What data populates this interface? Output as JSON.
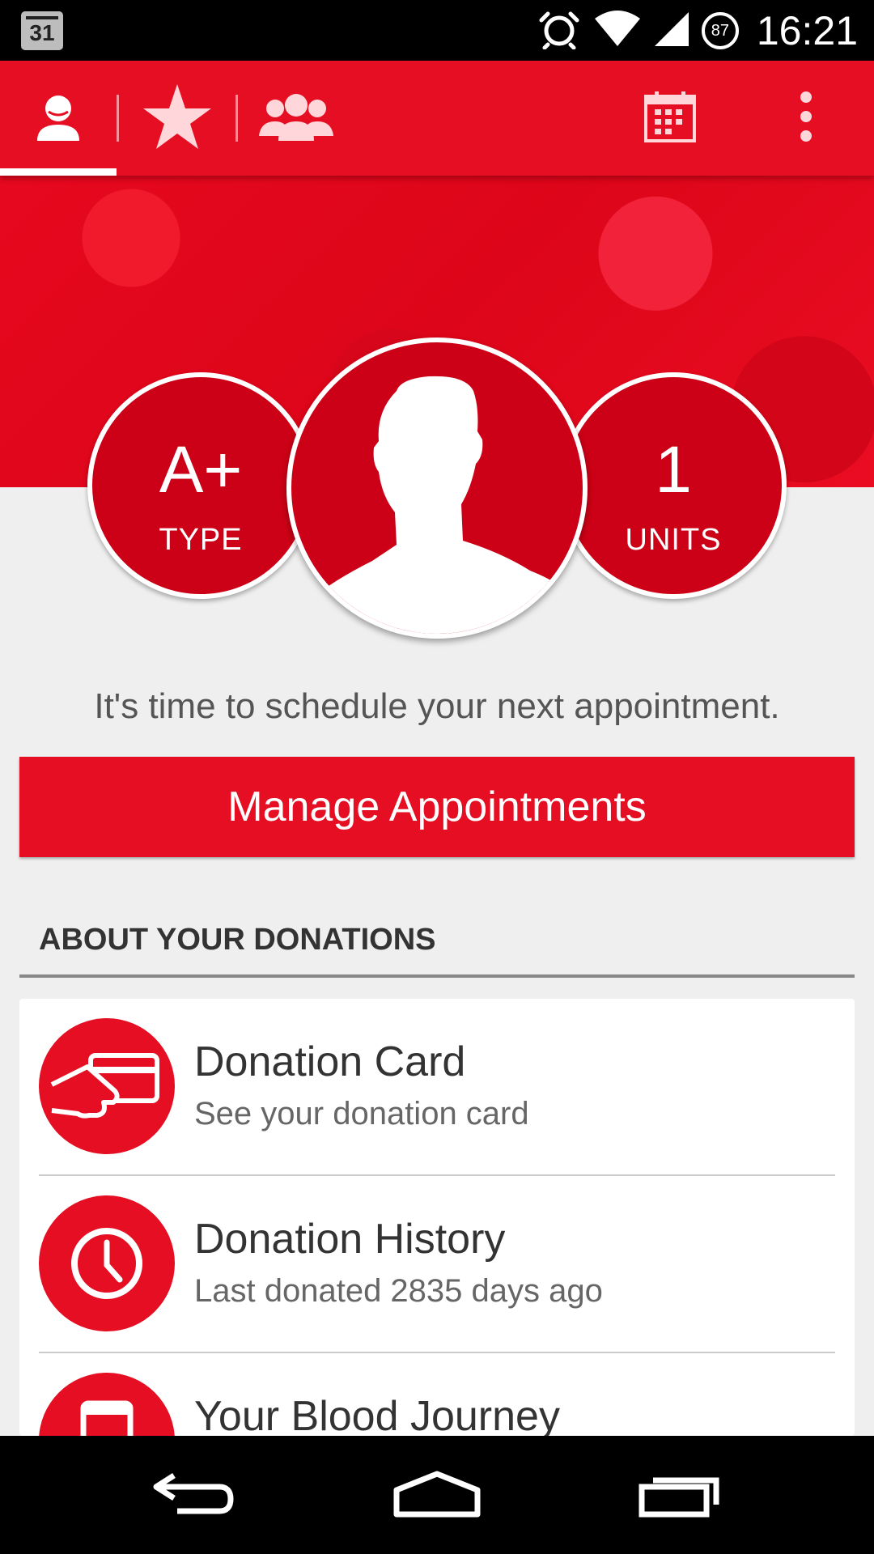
{
  "status_bar": {
    "calendar_day": "31",
    "battery_level": "87",
    "time": "16:21",
    "icons": [
      "calendar-icon",
      "alarm-icon",
      "wifi-icon",
      "signal-icon",
      "battery-icon"
    ]
  },
  "app_bar": {
    "tabs": [
      {
        "name": "profile",
        "icon": "person-icon",
        "active": true
      },
      {
        "name": "rewards",
        "icon": "star-icon",
        "active": false
      },
      {
        "name": "community",
        "icon": "group-icon",
        "active": false
      }
    ],
    "actions": [
      "calendar-icon",
      "overflow-menu-icon"
    ]
  },
  "profile": {
    "blood_type": "A+",
    "blood_type_label": "TYPE",
    "units": "1",
    "units_label": "UNITS"
  },
  "main": {
    "prompt": "It's time to schedule your next appointment.",
    "manage_button": "Manage Appointments",
    "section_title": "ABOUT YOUR DONATIONS",
    "items": [
      {
        "title": "Donation Card",
        "subtitle": "See your donation card",
        "icon": "card-hand-icon"
      },
      {
        "title": "Donation History",
        "subtitle": "Last donated 2835 days ago",
        "icon": "clock-icon"
      },
      {
        "title": "Your Blood Journey",
        "subtitle": "",
        "icon": "phone-icon"
      }
    ]
  },
  "nav_bar": {
    "buttons": [
      "back-icon",
      "home-icon",
      "recents-icon"
    ]
  },
  "colors": {
    "brand_red": "#e50e22",
    "dark_red": "#cc0016",
    "background": "#efefef"
  }
}
